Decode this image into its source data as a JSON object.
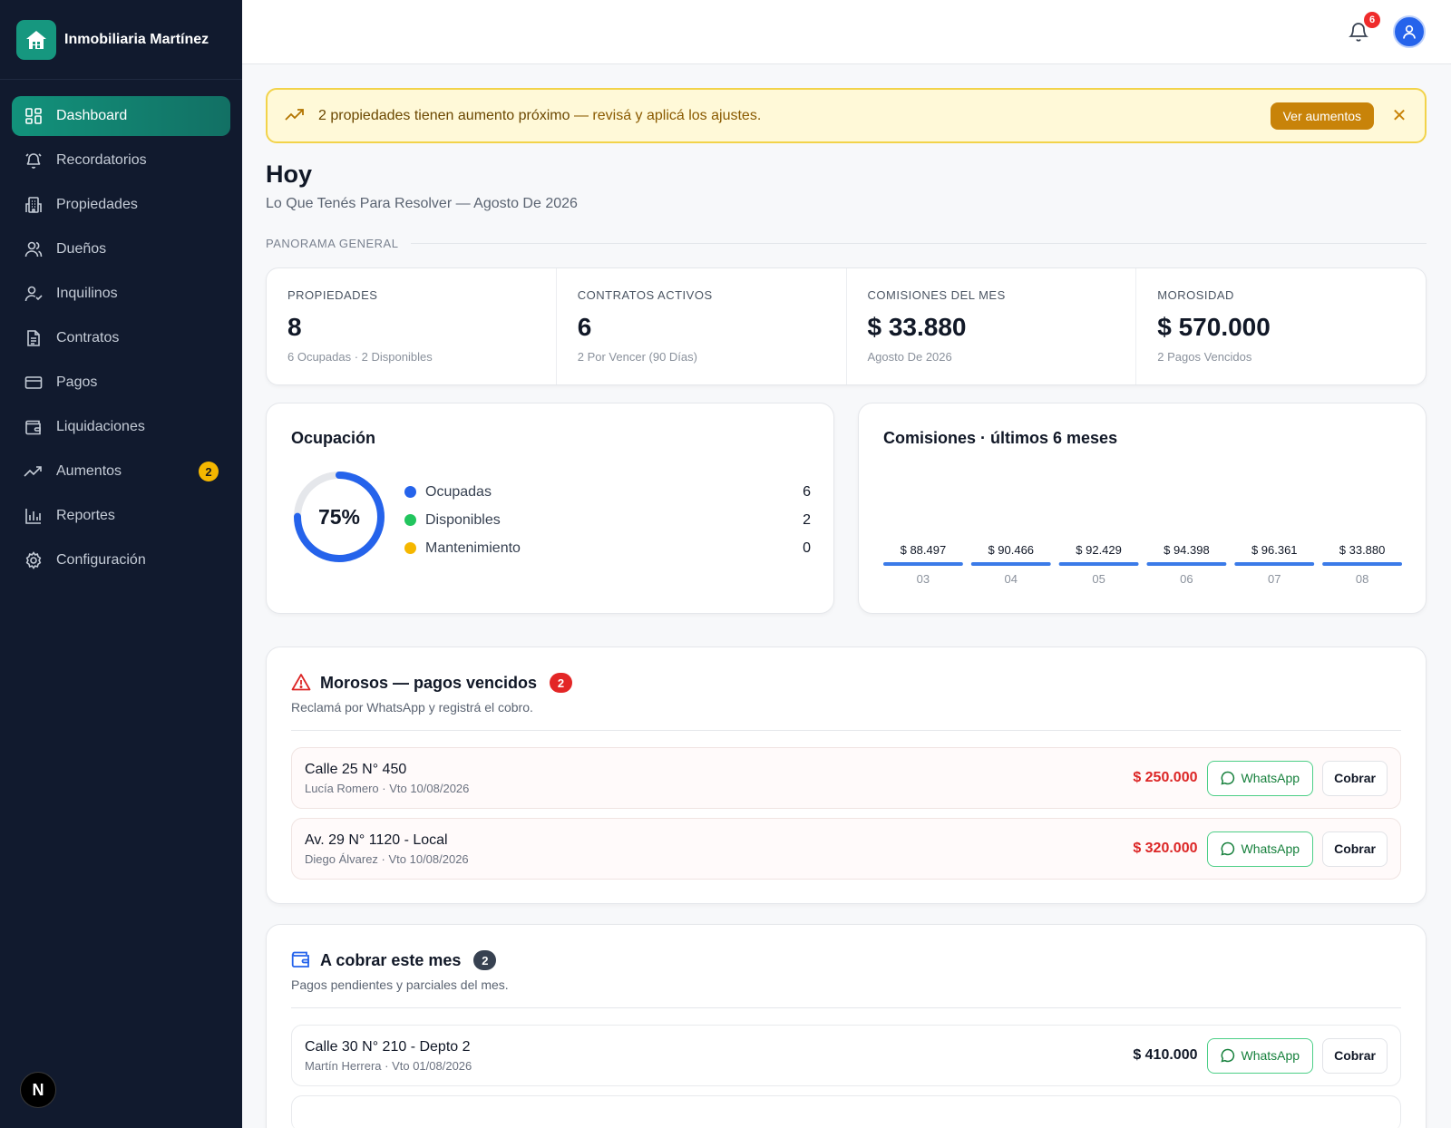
{
  "brand": {
    "name": "Inmobiliaria Martínez"
  },
  "nav": {
    "items": [
      {
        "label": "Dashboard",
        "icon": "dashboard-icon",
        "active": true
      },
      {
        "label": "Recordatorios",
        "icon": "bell-icon"
      },
      {
        "label": "Propiedades",
        "icon": "building-icon"
      },
      {
        "label": "Dueños",
        "icon": "users-icon"
      },
      {
        "label": "Inquilinos",
        "icon": "user-check-icon"
      },
      {
        "label": "Contratos",
        "icon": "document-icon"
      },
      {
        "label": "Pagos",
        "icon": "credit-card-icon"
      },
      {
        "label": "Liquidaciones",
        "icon": "wallet-icon"
      },
      {
        "label": "Aumentos",
        "icon": "trending-up-icon",
        "badge": "2"
      },
      {
        "label": "Reportes",
        "icon": "bar-chart-icon"
      },
      {
        "label": "Configuración",
        "icon": "gear-icon"
      }
    ]
  },
  "topbar": {
    "notifications_count": "6"
  },
  "banner": {
    "strong": "2 propiedades tienen aumento próximo",
    "rest": " — revisá y aplicá los ajustes.",
    "button": "Ver aumentos",
    "close": "✕"
  },
  "page": {
    "title": "Hoy",
    "subtitle": "Lo Que Tenés Para Resolver — Agosto De 2026",
    "section_label": "PANORAMA GENERAL"
  },
  "kpis": [
    {
      "label": "PROPIEDADES",
      "value": "8",
      "sub": "6 Ocupadas · 2 Disponibles"
    },
    {
      "label": "CONTRATOS ACTIVOS",
      "value": "6",
      "sub": "2 Por Vencer (90 Días)"
    },
    {
      "label": "COMISIONES DEL MES",
      "value": "$ 33.880",
      "sub": "Agosto De 2026"
    },
    {
      "label": "MOROSIDAD",
      "value": "$ 570.000",
      "sub": "2 Pagos Vencidos"
    }
  ],
  "occupancy": {
    "title": "Ocupación",
    "percent_label": "75%",
    "percent": 75,
    "legend": [
      {
        "name": "Ocupadas",
        "value": "6",
        "color": "#2563eb"
      },
      {
        "name": "Disponibles",
        "value": "2",
        "color": "#22c55e"
      },
      {
        "name": "Mantenimiento",
        "value": "0",
        "color": "#f5b700"
      }
    ],
    "accent": "#2563eb",
    "track": "#e5e7eb"
  },
  "chart_data": {
    "type": "bar",
    "title": "Comisiones · últimos 6 meses",
    "categories": [
      "03",
      "04",
      "05",
      "06",
      "07",
      "08"
    ],
    "value_labels": [
      "$ 88.497",
      "$ 90.466",
      "$ 92.429",
      "$ 94.398",
      "$ 96.361",
      "$ 33.880"
    ],
    "values": [
      88497,
      90466,
      92429,
      94398,
      96361,
      33880
    ],
    "color": "#3b7be8"
  },
  "morosos": {
    "title": "Morosos — pagos vencidos",
    "count": "2",
    "subtitle": "Reclamá por WhatsApp y registrá el cobro.",
    "items": [
      {
        "address": "Calle 25 N° 450",
        "meta": "Lucía Romero · Vto 10/08/2026",
        "amount": "$ 250.000"
      },
      {
        "address": "Av. 29 N° 1120 - Local",
        "meta": "Diego Álvarez · Vto 10/08/2026",
        "amount": "$ 320.000"
      }
    ]
  },
  "cobrar": {
    "title": "A cobrar este mes",
    "count": "2",
    "subtitle": "Pagos pendientes y parciales del mes.",
    "items": [
      {
        "address": "Calle 30 N° 210 - Depto 2",
        "meta": "Martín Herrera · Vto 01/08/2026",
        "amount": "$ 410.000"
      }
    ]
  },
  "actions": {
    "whatsapp": "WhatsApp",
    "cobrar": "Cobrar"
  },
  "next_badge": "N"
}
